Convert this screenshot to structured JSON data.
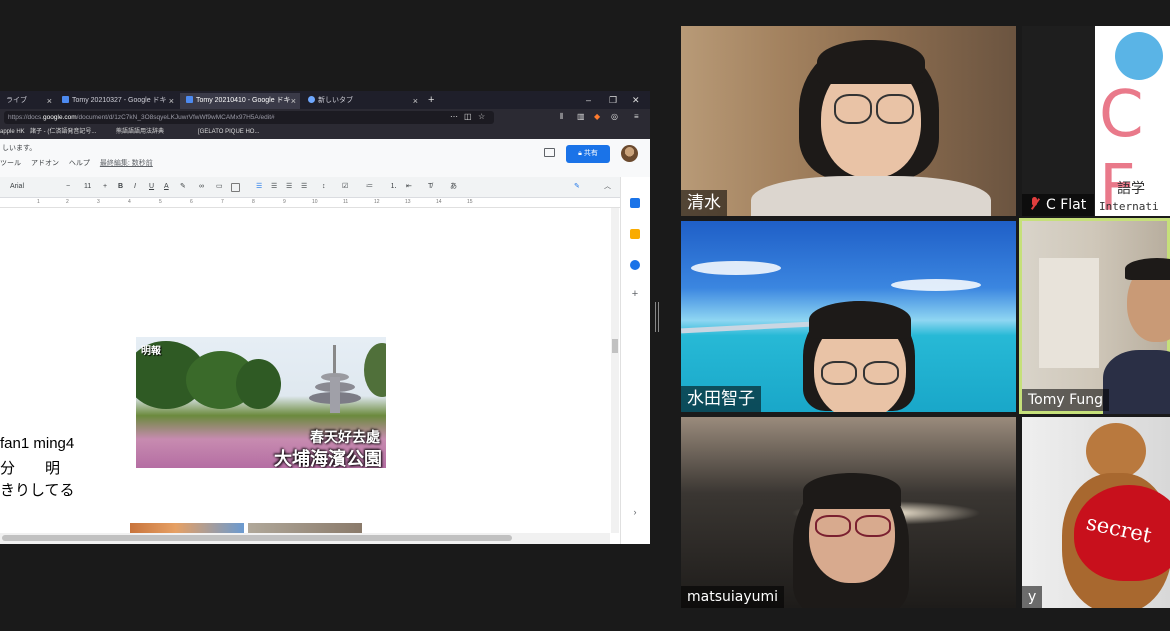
{
  "browser": {
    "tabs": [
      {
        "label": "ライブ",
        "active": false
      },
      {
        "label": "Tomy 20210327 - Google ドキ",
        "active": false
      },
      {
        "label": "Tomy 20210410 - Google ドキ",
        "active": true
      },
      {
        "label": "新しいタブ",
        "active": false
      }
    ],
    "new_tab": "+",
    "url_prefix": "https://docs.",
    "url_domain": "google.com",
    "url_rest": "/document/d/1zC7kN_3O8sqyeLKJuwrVfwWf9wMCAMx97H5A/edit#",
    "bookmarks": [
      {
        "label": "apple HK"
      },
      {
        "label": "諸子 - (仁済語発音記号..."
      },
      {
        "label": "熊語語語用法辞典"
      },
      {
        "label": "[GELATO PIQUE HO..."
      }
    ]
  },
  "docs": {
    "doc_name": "しいます。",
    "menu": [
      "ツール",
      "アドオン",
      "ヘルプ"
    ],
    "last_edit": "最終編集: 数秒前",
    "share_label": "共有",
    "font_name": "Arial",
    "font_size": "11",
    "toolbar_items": [
      "B",
      "I",
      "U",
      "A"
    ],
    "ruler": [
      "1",
      "2",
      "3",
      "4",
      "5",
      "6",
      "7",
      "8",
      "9",
      "10",
      "11",
      "12",
      "13",
      "14",
      "15"
    ],
    "lines": [
      "fan1 ming4",
      "分　　明",
      "きりしてる"
    ],
    "photo": {
      "logo": "明報",
      "caption_small": "春天好去處",
      "caption_large": "大埔海濱公園"
    }
  },
  "participants": [
    {
      "name": "清水",
      "muted": false,
      "speaking": false
    },
    {
      "name": "C Flat",
      "muted": true,
      "speaking": false,
      "logo_text": "C F",
      "logo_sub": "語学",
      "logo_sub2": "Internati"
    },
    {
      "name": "水田智子",
      "muted": false,
      "speaking": false
    },
    {
      "name": "Tomy Fung",
      "muted": false,
      "speaking": true
    },
    {
      "name": "matsuiayumi",
      "muted": false,
      "speaking": false
    },
    {
      "name": "y",
      "muted": false,
      "speaking": false,
      "heart_text": "secret"
    }
  ],
  "colors": {
    "background": "#1a1a1a",
    "speaking_border": "#c6e07a",
    "share_button": "#1a73e8",
    "muted_icon": "#e03e3e"
  }
}
